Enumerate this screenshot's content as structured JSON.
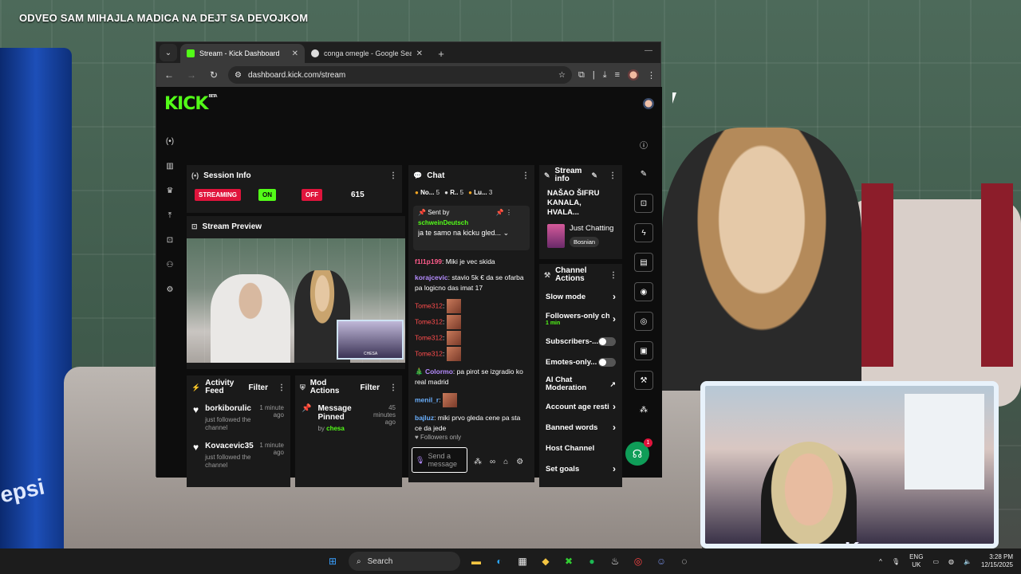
{
  "video_title": "ODVEO SAM MIHAJLA MADICA NA DEJT SA DEVOJKOM",
  "browser": {
    "tabs": [
      {
        "title": "Stream - Kick Dashboard",
        "active": true,
        "favicon_color": "#53fc18"
      },
      {
        "title": "conga omegle - Google Search",
        "active": false,
        "favicon_color": "#dddddd"
      }
    ],
    "new_tab": "+",
    "url": "dashboard.kick.com/stream"
  },
  "kick": {
    "logo": "KICK",
    "logo_badge": "BETA",
    "session": {
      "title": "Session Info",
      "streaming": "STREAMING",
      "on": "ON",
      "off": "OFF",
      "viewers": "615"
    },
    "preview": {
      "title": "Stream Preview",
      "cam_label": "CHESA"
    },
    "activity": {
      "title": "Activity Feed",
      "filter": "Filter",
      "items": [
        {
          "name": "borkiborulic",
          "sub": "just followed the channel",
          "time": "1 minute ago"
        },
        {
          "name": "Kovacevic35",
          "sub": "just followed the channel",
          "time": "1 minute ago"
        }
      ]
    },
    "mod": {
      "title": "Mod Actions",
      "filter": "Filter",
      "item_title": "Message Pinned",
      "item_time": "45 minutes ago",
      "by": "by",
      "by_user": "chesa"
    },
    "chat": {
      "title": "Chat",
      "tabs": [
        "No...",
        "5",
        "R..",
        "5",
        "Lu...",
        "3"
      ],
      "pinned_label": "Sent by",
      "pinned_user": "schweinDeutsch",
      "pinned_msg": "ja te samo na kicku gled...",
      "messages": [
        {
          "user": "f1l1p199",
          "text": "Miki je vec skida"
        },
        {
          "user": "korajcevic",
          "text": "stavio 5k € da se ofarba pa logicno das imat 17"
        },
        {
          "user": "Tome312",
          "text": ""
        },
        {
          "user": "Tome312",
          "text": ""
        },
        {
          "user": "Tome312",
          "text": ""
        },
        {
          "user": "Tome312",
          "text": ""
        },
        {
          "user": "Colormo",
          "text": "pa pirot se izgradio ko real madrid"
        },
        {
          "user": "menil_r",
          "text": ""
        },
        {
          "user": "bajluz",
          "text": "miki prvo gleda cene pa sta ce da jede"
        }
      ],
      "followers_only": "Followers only",
      "input_placeholder": "Send a message"
    },
    "stream_info": {
      "title": "Stream info",
      "stream_title": "NAŠAO ŠIFRU KANALA, HVALA...",
      "category": "Just Chatting",
      "language": "Bosnian"
    },
    "channel_actions": {
      "title": "Channel Actions",
      "items": [
        {
          "label": "Slow mode",
          "kind": "chevron"
        },
        {
          "label": "Followers-only ch",
          "sub": "1 min",
          "kind": "chevron"
        },
        {
          "label": "Subscribers-...",
          "kind": "toggle"
        },
        {
          "label": "Emotes-only...",
          "kind": "toggle"
        },
        {
          "label": "AI Chat Moderation",
          "kind": "external"
        },
        {
          "label": "Account age resti",
          "kind": "chevron"
        },
        {
          "label": "Banned words",
          "kind": "chevron"
        },
        {
          "label": "Host Channel",
          "kind": "none"
        },
        {
          "label": "Set goals",
          "kind": "chevron"
        }
      ]
    },
    "help_badge": "1"
  },
  "taskbar": {
    "search": "Search",
    "lang_top": "ENG",
    "lang_bottom": "UK",
    "time": "3:28 PM",
    "date": "12/15/2025"
  }
}
